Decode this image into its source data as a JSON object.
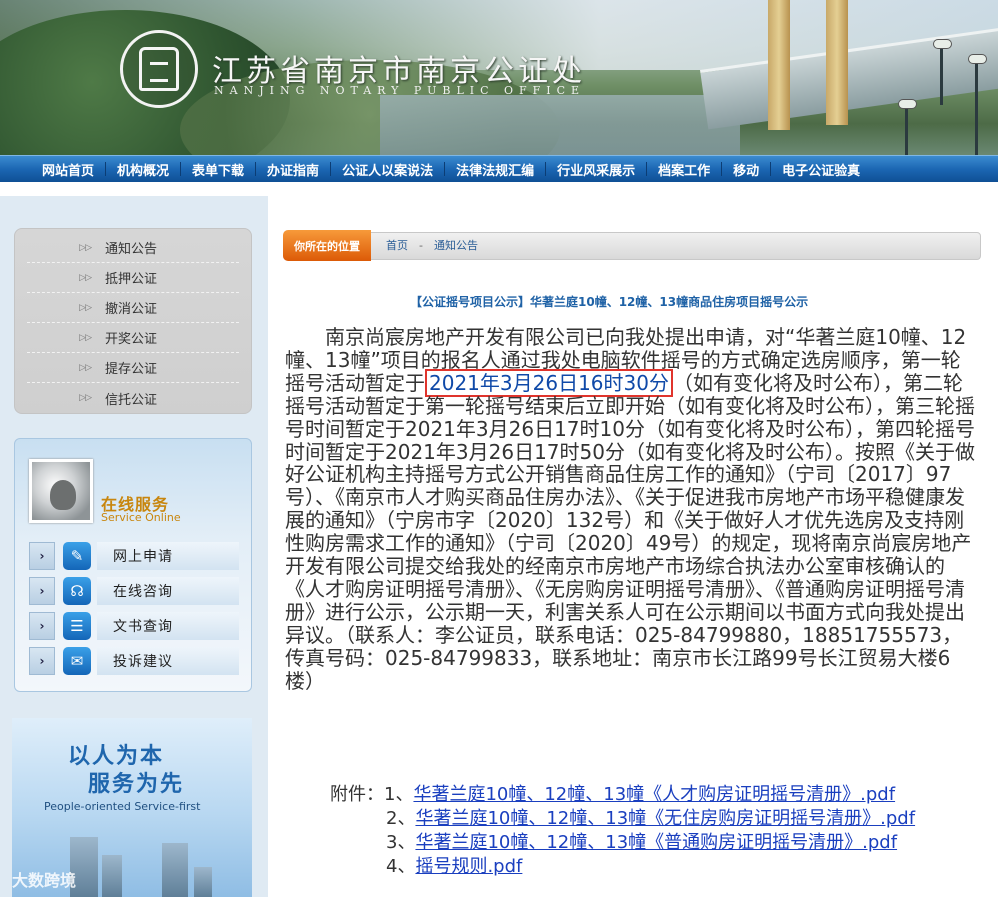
{
  "header": {
    "site_title": "江苏省南京市南京公证处",
    "site_subtitle": "NANJING NOTARY PUBLIC OFFICE",
    "logo_text": "南京公证处 NANJING NOTARY PUBLIC OFFICE"
  },
  "nav": {
    "items": [
      {
        "label": "网站首页"
      },
      {
        "label": "机构概况"
      },
      {
        "label": "表单下载"
      },
      {
        "label": "办证指南"
      },
      {
        "label": "公证人以案说法"
      },
      {
        "label": "法律法规汇编"
      },
      {
        "label": "行业风采展示"
      },
      {
        "label": "档案工作"
      },
      {
        "label": "移动"
      },
      {
        "label": "电子公证验真"
      }
    ]
  },
  "sidebar": {
    "menu": [
      {
        "label": "通知公告"
      },
      {
        "label": "抵押公证"
      },
      {
        "label": "撤消公证"
      },
      {
        "label": "开奖公证"
      },
      {
        "label": "提存公证"
      },
      {
        "label": "信托公证"
      }
    ],
    "menu_arrow": "▷▷",
    "service": {
      "title": "在线服务",
      "subtitle": "Service Online",
      "items": [
        {
          "label": "网上申请",
          "icon": "edit-icon"
        },
        {
          "label": "在线咨询",
          "icon": "headset-icon"
        },
        {
          "label": "文书查询",
          "icon": "list-icon"
        },
        {
          "label": "投诉建议",
          "icon": "chat-icon"
        }
      ],
      "chevron": "›"
    },
    "promo": {
      "line1": "以人为本",
      "line2": "服务为先",
      "english": "People-oriented  Service-first",
      "watermark": "大数跨境"
    }
  },
  "breadcrumb": {
    "location_label": "你所在的位置",
    "home": "首页",
    "separator": "-",
    "current": "通知公告"
  },
  "article": {
    "title": "【公证摇号项目公示】华著兰庭10幢、12幢、13幢商品住房项目摇号公示",
    "body_before": "南京尚宸房地产开发有限公司已向我处提出申请，对“华著兰庭10幢、12幢、13幢”项目的报名人通过我处电脑软件摇号的方式确定选房顺序，第一轮摇号活动暂定于",
    "highlight": "2021年3月26日16时30分",
    "body_after": "（如有变化将及时公布），第二轮摇号活动暂定于第一轮摇号结束后立即开始（如有变化将及时公布），第三轮摇号时间暂定于2021年3月26日17时10分（如有变化将及时公布），第四轮摇号时间暂定于2021年3月26日17时50分（如有变化将及时公布）。按照《关于做好公证机构主持摇号方式公开销售商品住房工作的通知》（宁司〔2017〕97号）、《南京市人才购买商品住房办法》、《关于促进我市房地产市场平稳健康发展的通知》（宁房市字〔2020〕132号）和《关于做好人才优先选房及支持刚性购房需求工作的通知》（宁司〔2020〕49号）的规定，现将南京尚宸房地产开发有限公司提交给我处的经南京市房地产市场综合执法办公室审核确认的《人才购房证明摇号清册》、《无房购房证明摇号清册》、《普通购房证明摇号清册》进行公示，公示期一天，利害关系人可在公示期间以书面方式向我处提出异议。（联系人：李公证员，联系电话：025-84799880，18851755573，传真号码：025-84799833，联系地址：南京市长江路99号长江贸易大楼6楼）",
    "attachments_label": "附件：",
    "attachments": [
      {
        "num": "1、",
        "name": "华著兰庭10幢、12幢、13幢《人才购房证明摇号清册》.pdf"
      },
      {
        "num": "2、",
        "name": "华著兰庭10幢、12幢、13幢《无住房购房证明摇号清册》.pdf"
      },
      {
        "num": "3、",
        "name": "华著兰庭10幢、12幢、13幢《普通购房证明摇号清册》.pdf"
      },
      {
        "num": "4、",
        "name": "摇号规则.pdf"
      }
    ]
  },
  "colors": {
    "nav_blue": "#1c67b3",
    "link_blue": "#1a3fbf",
    "highlight_border": "#e0342c",
    "accent_orange": "#dc5a07"
  }
}
